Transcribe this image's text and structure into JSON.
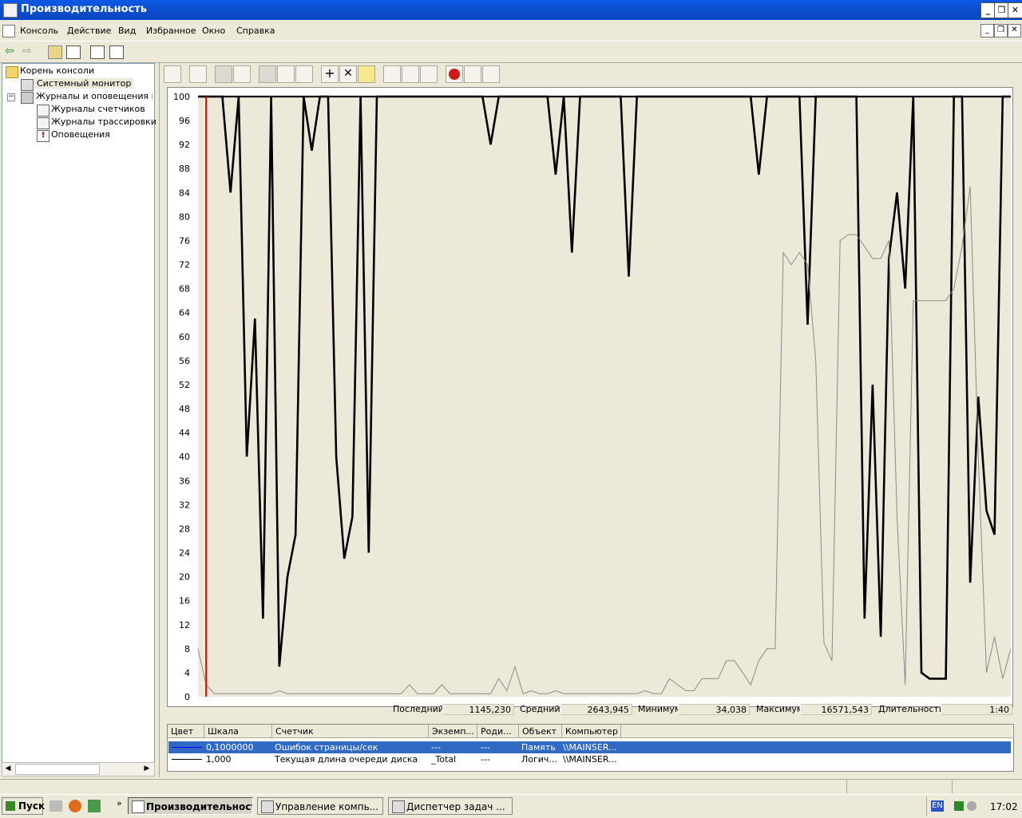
{
  "window": {
    "title": "Производительность"
  },
  "menu": [
    "Консоль",
    "Действие",
    "Вид",
    "Избранное",
    "Окно",
    "Справка"
  ],
  "tree": {
    "root": "Корень консоли",
    "items": [
      {
        "label": "Системный монитор",
        "level": 1
      },
      {
        "label": "Журналы и оповещения производительности",
        "level": 1
      },
      {
        "label": "Журналы счетчиков",
        "level": 2
      },
      {
        "label": "Журналы трассировки",
        "level": 2
      },
      {
        "label": "Оповещения",
        "level": 2
      }
    ]
  },
  "stats": {
    "last_label": "Последний",
    "last_value": "1145,230",
    "avg_label": "Средний",
    "avg_value": "2643,945",
    "min_label": "Минимум",
    "min_value": "34,038",
    "max_label": "Максимум",
    "max_value": "16571,543",
    "dur_label": "Длительность",
    "dur_value": "1:40"
  },
  "legend": {
    "headers": [
      "Цвет",
      "Шкала",
      "Счетчик",
      "Экземп...",
      "Роди...",
      "Объект",
      "Компьютер"
    ],
    "rows": [
      {
        "scale": "0,1000000",
        "counter": "Ошибок страницы/сек",
        "instance": "---",
        "parent": "---",
        "object": "Память",
        "computer": "\\\\MAINSER...",
        "selected": true
      },
      {
        "scale": "1,000",
        "counter": "Текущая длина очереди диска",
        "instance": "_Total",
        "parent": "---",
        "object": "Логич...",
        "computer": "\\\\MAINSER...",
        "selected": false
      }
    ]
  },
  "taskbar": {
    "start": "Пуск",
    "tasks": [
      "Производительность",
      "Управление компь...",
      "Диспетчер задач ..."
    ],
    "lang": "EN",
    "clock": "17:02"
  },
  "chart_data": {
    "type": "line",
    "ylim": [
      0,
      100
    ],
    "yticks": [
      "100",
      "96",
      "92",
      "88",
      "84",
      "80",
      "76",
      "72",
      "68",
      "64",
      "60",
      "56",
      "52",
      "48",
      "44",
      "40",
      "36",
      "32",
      "28",
      "24",
      "20",
      "16",
      "12",
      "8",
      "4",
      "0"
    ],
    "x": [
      0,
      1,
      2,
      3,
      4,
      5,
      6,
      7,
      8,
      9,
      10,
      11,
      12,
      13,
      14,
      15,
      16,
      17,
      18,
      19,
      20,
      21,
      22,
      23,
      24,
      25,
      26,
      27,
      28,
      29,
      30,
      31,
      32,
      33,
      34,
      35,
      36,
      37,
      38,
      39,
      40,
      41,
      42,
      43,
      44,
      45,
      46,
      47,
      48,
      49,
      50,
      51,
      52,
      53,
      54,
      55,
      56,
      57,
      58,
      59,
      60,
      61,
      62,
      63,
      64,
      65,
      66,
      67,
      68,
      69,
      70,
      71,
      72,
      73,
      74,
      75,
      76,
      77,
      78,
      79,
      80,
      81,
      82,
      83,
      84,
      85,
      86,
      87,
      88,
      89,
      90,
      91,
      92,
      93,
      94,
      95,
      96,
      97,
      98,
      99,
      100
    ],
    "series": [
      {
        "values": [
          100,
          100,
          100,
          100,
          100,
          100,
          100,
          100,
          100,
          100,
          100,
          100,
          100,
          100,
          100,
          100,
          100,
          100,
          100,
          100,
          100,
          100,
          100,
          100,
          100,
          100,
          100,
          100,
          100,
          100,
          100,
          100,
          100,
          100,
          100,
          100,
          100,
          100,
          100,
          100,
          100,
          100,
          100,
          100,
          100,
          100,
          100,
          100,
          100,
          100,
          100,
          100,
          100,
          100,
          100,
          100,
          100,
          100,
          100,
          100,
          100,
          100,
          100,
          100,
          100,
          100,
          100,
          100,
          100,
          100,
          100,
          100,
          100,
          100,
          100,
          100,
          100,
          100,
          100,
          100,
          100,
          100,
          100,
          100,
          100,
          100,
          100,
          100,
          100,
          100,
          100,
          100,
          100,
          100,
          100,
          100,
          100,
          100,
          100,
          100,
          100
        ]
      },
      {
        "values": [
          100,
          100,
          100,
          100,
          84,
          100,
          40,
          63,
          13,
          100,
          5,
          20,
          27,
          100,
          91,
          100,
          100,
          40,
          23,
          30,
          100,
          24,
          100,
          100,
          100,
          100,
          100,
          100,
          100,
          100,
          100,
          100,
          100,
          100,
          100,
          100,
          92,
          100,
          100,
          100,
          100,
          100,
          100,
          100,
          87,
          100,
          74,
          100,
          100,
          100,
          100,
          100,
          100,
          70,
          100,
          100,
          100,
          100,
          100,
          100,
          100,
          100,
          100,
          100,
          100,
          100,
          100,
          100,
          100,
          87,
          100,
          100,
          100,
          100,
          100,
          62,
          100,
          100,
          100,
          100,
          100,
          100,
          13,
          52,
          10,
          73,
          84,
          68,
          100,
          4,
          3,
          3,
          3,
          100,
          100,
          19,
          50,
          31,
          27,
          100,
          100
        ]
      },
      {
        "values": [
          8,
          2,
          0.5,
          0.5,
          0.5,
          0.5,
          0.5,
          0.5,
          0.5,
          0.5,
          1,
          0.5,
          0.5,
          0.5,
          0.5,
          0.5,
          0.5,
          0.5,
          0.5,
          0.5,
          0.5,
          0.5,
          0.5,
          0.5,
          0.5,
          0.5,
          2,
          0.5,
          0.5,
          0.5,
          2,
          0.5,
          0.5,
          0.5,
          0.5,
          0.5,
          0.5,
          3,
          1,
          5,
          0.5,
          1,
          0.5,
          0.5,
          1,
          0.5,
          0.5,
          0.5,
          0.5,
          0.5,
          0.5,
          0.5,
          0.5,
          0.5,
          0.5,
          1,
          0.5,
          0.5,
          3,
          2,
          1,
          1,
          3,
          3,
          3,
          6,
          6,
          4,
          2,
          6,
          8,
          8,
          74,
          72,
          74,
          72,
          56,
          9,
          6,
          76,
          77,
          77,
          75,
          73,
          73,
          76,
          30,
          2,
          66,
          66,
          66,
          66,
          66,
          68,
          75,
          85,
          40,
          4,
          10,
          3,
          8
        ]
      }
    ]
  }
}
